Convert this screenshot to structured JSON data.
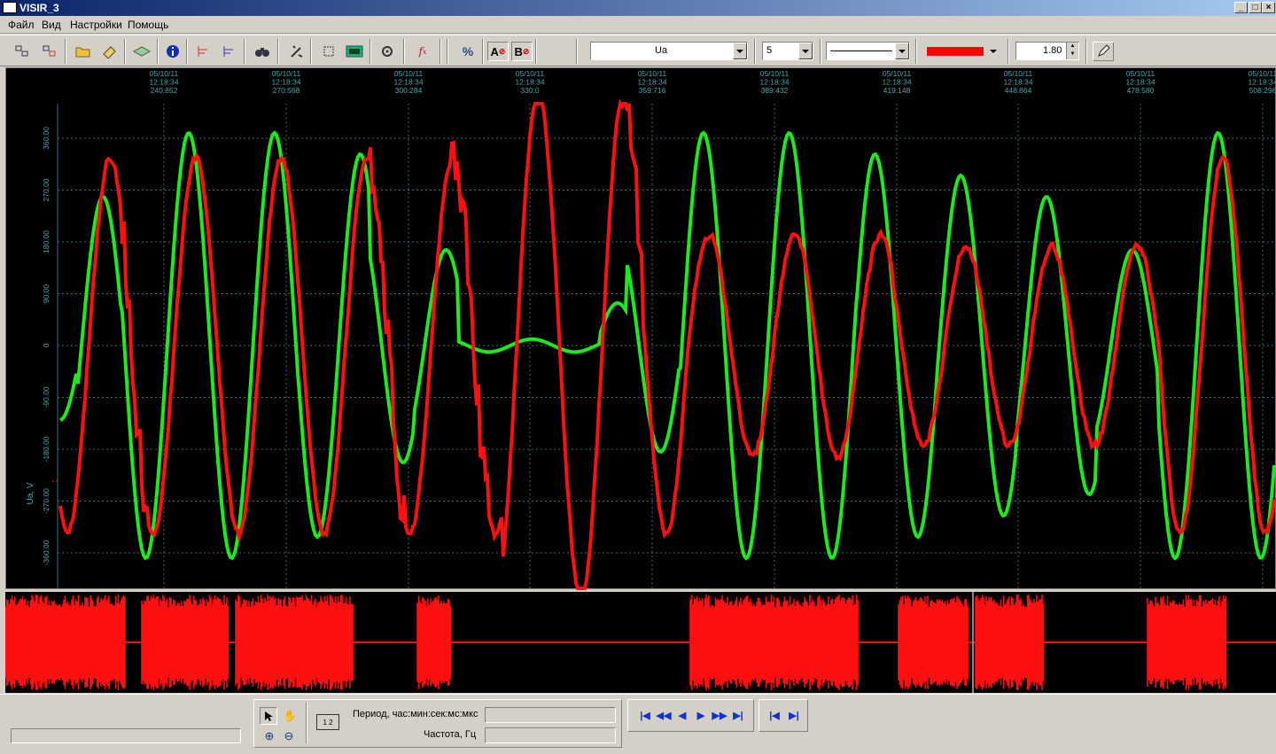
{
  "window": {
    "title": "VISIR_3"
  },
  "menu": [
    "Файл",
    "Вид",
    "Настройки",
    "Помощь"
  ],
  "toolbar": {
    "channel_select": "Ua",
    "width_select": "5",
    "color": "#ff0000",
    "scale_value": "1.80"
  },
  "time_axis": [
    {
      "date": "05/10/11",
      "time": "12:18:34",
      "ms": "240:852"
    },
    {
      "date": "05/10/11",
      "time": "12:18:34",
      "ms": "270:568"
    },
    {
      "date": "05/10/11",
      "time": "12:18:34",
      "ms": "300:284"
    },
    {
      "date": "05/10/11",
      "time": "12:18:34",
      "ms": "330:0"
    },
    {
      "date": "05/10/11",
      "time": "12:18:34",
      "ms": "359:716"
    },
    {
      "date": "05/10/11",
      "time": "12:18:34",
      "ms": "389:432"
    },
    {
      "date": "05/10/11",
      "time": "12:18:34",
      "ms": "419:148"
    },
    {
      "date": "05/10/11",
      "time": "12:18:34",
      "ms": "448:864"
    },
    {
      "date": "05/10/11",
      "time": "12:18:34",
      "ms": "478:580"
    },
    {
      "date": "05/10/11",
      "time": "12:18:34",
      "ms": "508:296"
    }
  ],
  "y_axis": {
    "label": "Ua, V",
    "ticks": [
      "360.00",
      "270.00",
      "180.00",
      "90.00",
      "0",
      "-90.00",
      "-180.00",
      "-270.00",
      "-360.00"
    ]
  },
  "colors": {
    "green_trace": "#1ee81e",
    "red_trace": "#ff1010",
    "grid": "#3a6e78",
    "axis_text": "#4aa6b0"
  },
  "status": {
    "period_label": "Период, час:мин:сек:мс:мкс",
    "period_value": "",
    "freq_label": "Частота, Гц",
    "freq_value": "",
    "ruler_label": "1 2"
  }
}
